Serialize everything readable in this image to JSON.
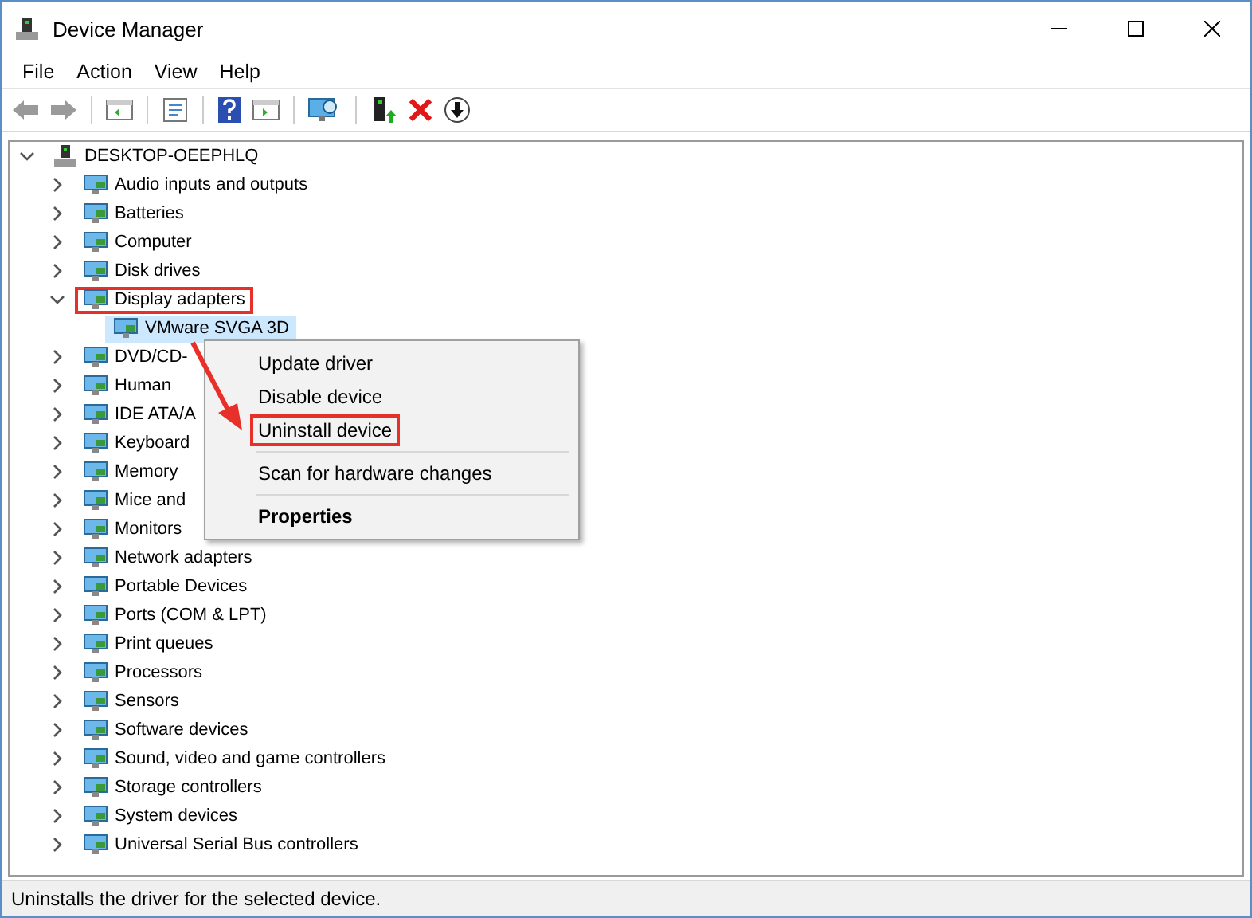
{
  "window": {
    "title": "Device Manager"
  },
  "menu_bar": [
    "File",
    "Action",
    "View",
    "Help"
  ],
  "tree": {
    "label": "DESKTOP-OEEPHLQ",
    "expanded": true,
    "selected": false,
    "highlighted": false,
    "children": [
      {
        "label": "Audio inputs and outputs",
        "expanded": false,
        "selected": false,
        "highlighted": false
      },
      {
        "label": "Batteries",
        "expanded": false,
        "selected": false,
        "highlighted": false
      },
      {
        "label": "Computer",
        "expanded": false,
        "selected": false,
        "highlighted": false
      },
      {
        "label": "Disk drives",
        "expanded": false,
        "selected": false,
        "highlighted": false
      },
      {
        "label": "Display adapters",
        "expanded": true,
        "selected": false,
        "highlighted": true,
        "children": [
          {
            "label": "VMware SVGA 3D",
            "selected": true,
            "highlighted": false
          }
        ]
      },
      {
        "label": "DVD/CD-",
        "expanded": false,
        "selected": false,
        "highlighted": false
      },
      {
        "label": "Human",
        "expanded": false,
        "selected": false,
        "highlighted": false
      },
      {
        "label": "IDE ATA/A",
        "expanded": false,
        "selected": false,
        "highlighted": false
      },
      {
        "label": "Keyboard",
        "expanded": false,
        "selected": false,
        "highlighted": false
      },
      {
        "label": "Memory",
        "expanded": false,
        "selected": false,
        "highlighted": false
      },
      {
        "label": "Mice and",
        "expanded": false,
        "selected": false,
        "highlighted": false
      },
      {
        "label": "Monitors",
        "expanded": false,
        "selected": false,
        "highlighted": false
      },
      {
        "label": "Network adapters",
        "expanded": false,
        "selected": false,
        "highlighted": false
      },
      {
        "label": "Portable Devices",
        "expanded": false,
        "selected": false,
        "highlighted": false
      },
      {
        "label": "Ports (COM & LPT)",
        "expanded": false,
        "selected": false,
        "highlighted": false
      },
      {
        "label": "Print queues",
        "expanded": false,
        "selected": false,
        "highlighted": false
      },
      {
        "label": "Processors",
        "expanded": false,
        "selected": false,
        "highlighted": false
      },
      {
        "label": "Sensors",
        "expanded": false,
        "selected": false,
        "highlighted": false
      },
      {
        "label": "Software devices",
        "expanded": false,
        "selected": false,
        "highlighted": false
      },
      {
        "label": "Sound, video and game controllers",
        "expanded": false,
        "selected": false,
        "highlighted": false
      },
      {
        "label": "Storage controllers",
        "expanded": false,
        "selected": false,
        "highlighted": false
      },
      {
        "label": "System devices",
        "expanded": false,
        "selected": false,
        "highlighted": false
      },
      {
        "label": "Universal Serial Bus controllers",
        "expanded": false,
        "selected": false,
        "highlighted": false
      }
    ]
  },
  "context_menu": {
    "groups": [
      [
        {
          "label": "Update driver",
          "bold": false,
          "highlighted": false
        },
        {
          "label": "Disable device",
          "bold": false,
          "highlighted": false
        },
        {
          "label": "Uninstall device",
          "bold": false,
          "highlighted": true
        }
      ],
      [
        {
          "label": "Scan for hardware changes",
          "bold": false,
          "highlighted": false
        }
      ],
      [
        {
          "label": "Properties",
          "bold": true,
          "highlighted": false
        }
      ]
    ]
  },
  "status_bar": "Uninstalls the driver for the selected device."
}
